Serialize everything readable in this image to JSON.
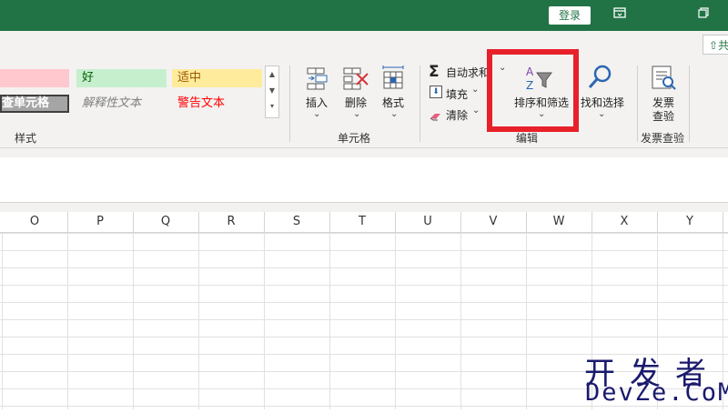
{
  "titlebar": {
    "login_label": "登录",
    "restore_icon": "ribbon-display-icon",
    "window_icon": "restore-window-icon"
  },
  "ribbon": {
    "share_partial": "共",
    "styles": {
      "bad_label": "",
      "good_label": "好",
      "neutral_label": "适中",
      "check_cell_label": "查单元格",
      "explanatory_label": "解释性文本",
      "warning_label": "警告文本",
      "group_label": "样式"
    },
    "cells": {
      "insert_label": "插入",
      "delete_label": "删除",
      "format_label": "格式",
      "group_label": "单元格"
    },
    "editing": {
      "autosum_label": "自动求和",
      "fill_label": "填充",
      "clear_label": "清除",
      "sort_filter_label": "排序和筛选",
      "find_select_label": "查找和选择",
      "find_select_visible": "找和选择",
      "group_label": "编辑"
    },
    "invoice": {
      "check_label_line1": "发票",
      "check_label_line2": "查验",
      "group_label": "发票查验"
    }
  },
  "grid": {
    "columns": [
      "O",
      "P",
      "Q",
      "R",
      "S",
      "T",
      "U",
      "V",
      "W",
      "X",
      "Y"
    ]
  },
  "watermark": {
    "cn": "开发者",
    "en": "DevZe.CoM"
  },
  "colors": {
    "excel_green": "#217346",
    "highlight_red": "#e8202a",
    "bad_fill": "#ffc7ce",
    "good_fill": "#c6efce",
    "neutral_fill": "#ffeb9c",
    "warning_text": "#ff0000"
  }
}
